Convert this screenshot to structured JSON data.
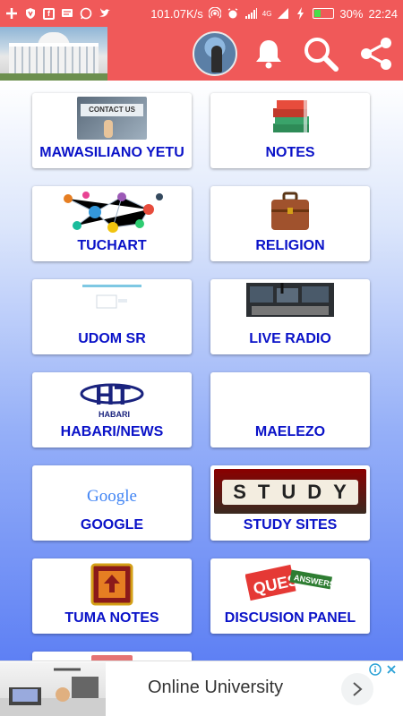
{
  "status_bar": {
    "speed": "101.07K/s",
    "network": "4G",
    "battery": "30%",
    "battery_level": 0.3,
    "time": "22:24"
  },
  "colors": {
    "accent": "#f05959",
    "label": "#0a12c8"
  },
  "tiles": [
    {
      "label": "MAWASILIANO YETU",
      "icon": "contact-us-image",
      "image_text": "CONTACT US"
    },
    {
      "label": "NOTES",
      "icon": "books-image"
    },
    {
      "label": "TUCHART",
      "icon": "network-people-image"
    },
    {
      "label": "RELIGION",
      "icon": "briefcase-image"
    },
    {
      "label": "UDOM SR",
      "icon": "webpage-image"
    },
    {
      "label": "LIVE RADIO",
      "icon": "radio-studio-image"
    },
    {
      "label": "HABARI/NEWS",
      "icon": "ht-habari-logo",
      "image_text": "HT",
      "image_subtext": "HABARI"
    },
    {
      "label": "MAELEZO",
      "icon": "blank-image"
    },
    {
      "label": "GOOGLE",
      "icon": "google-logo",
      "image_text": "Google"
    },
    {
      "label": "STUDY SITES",
      "icon": "study-blocks-image",
      "image_text": "STUDY"
    },
    {
      "label": "TUMA NOTES",
      "icon": "upload-chest-image"
    },
    {
      "label": "DISCUSION PANEL",
      "icon": "questions-answers-image",
      "image_text": "QUES",
      "image_subtext": "ANSWERS"
    }
  ],
  "ad": {
    "title": "Online University"
  }
}
